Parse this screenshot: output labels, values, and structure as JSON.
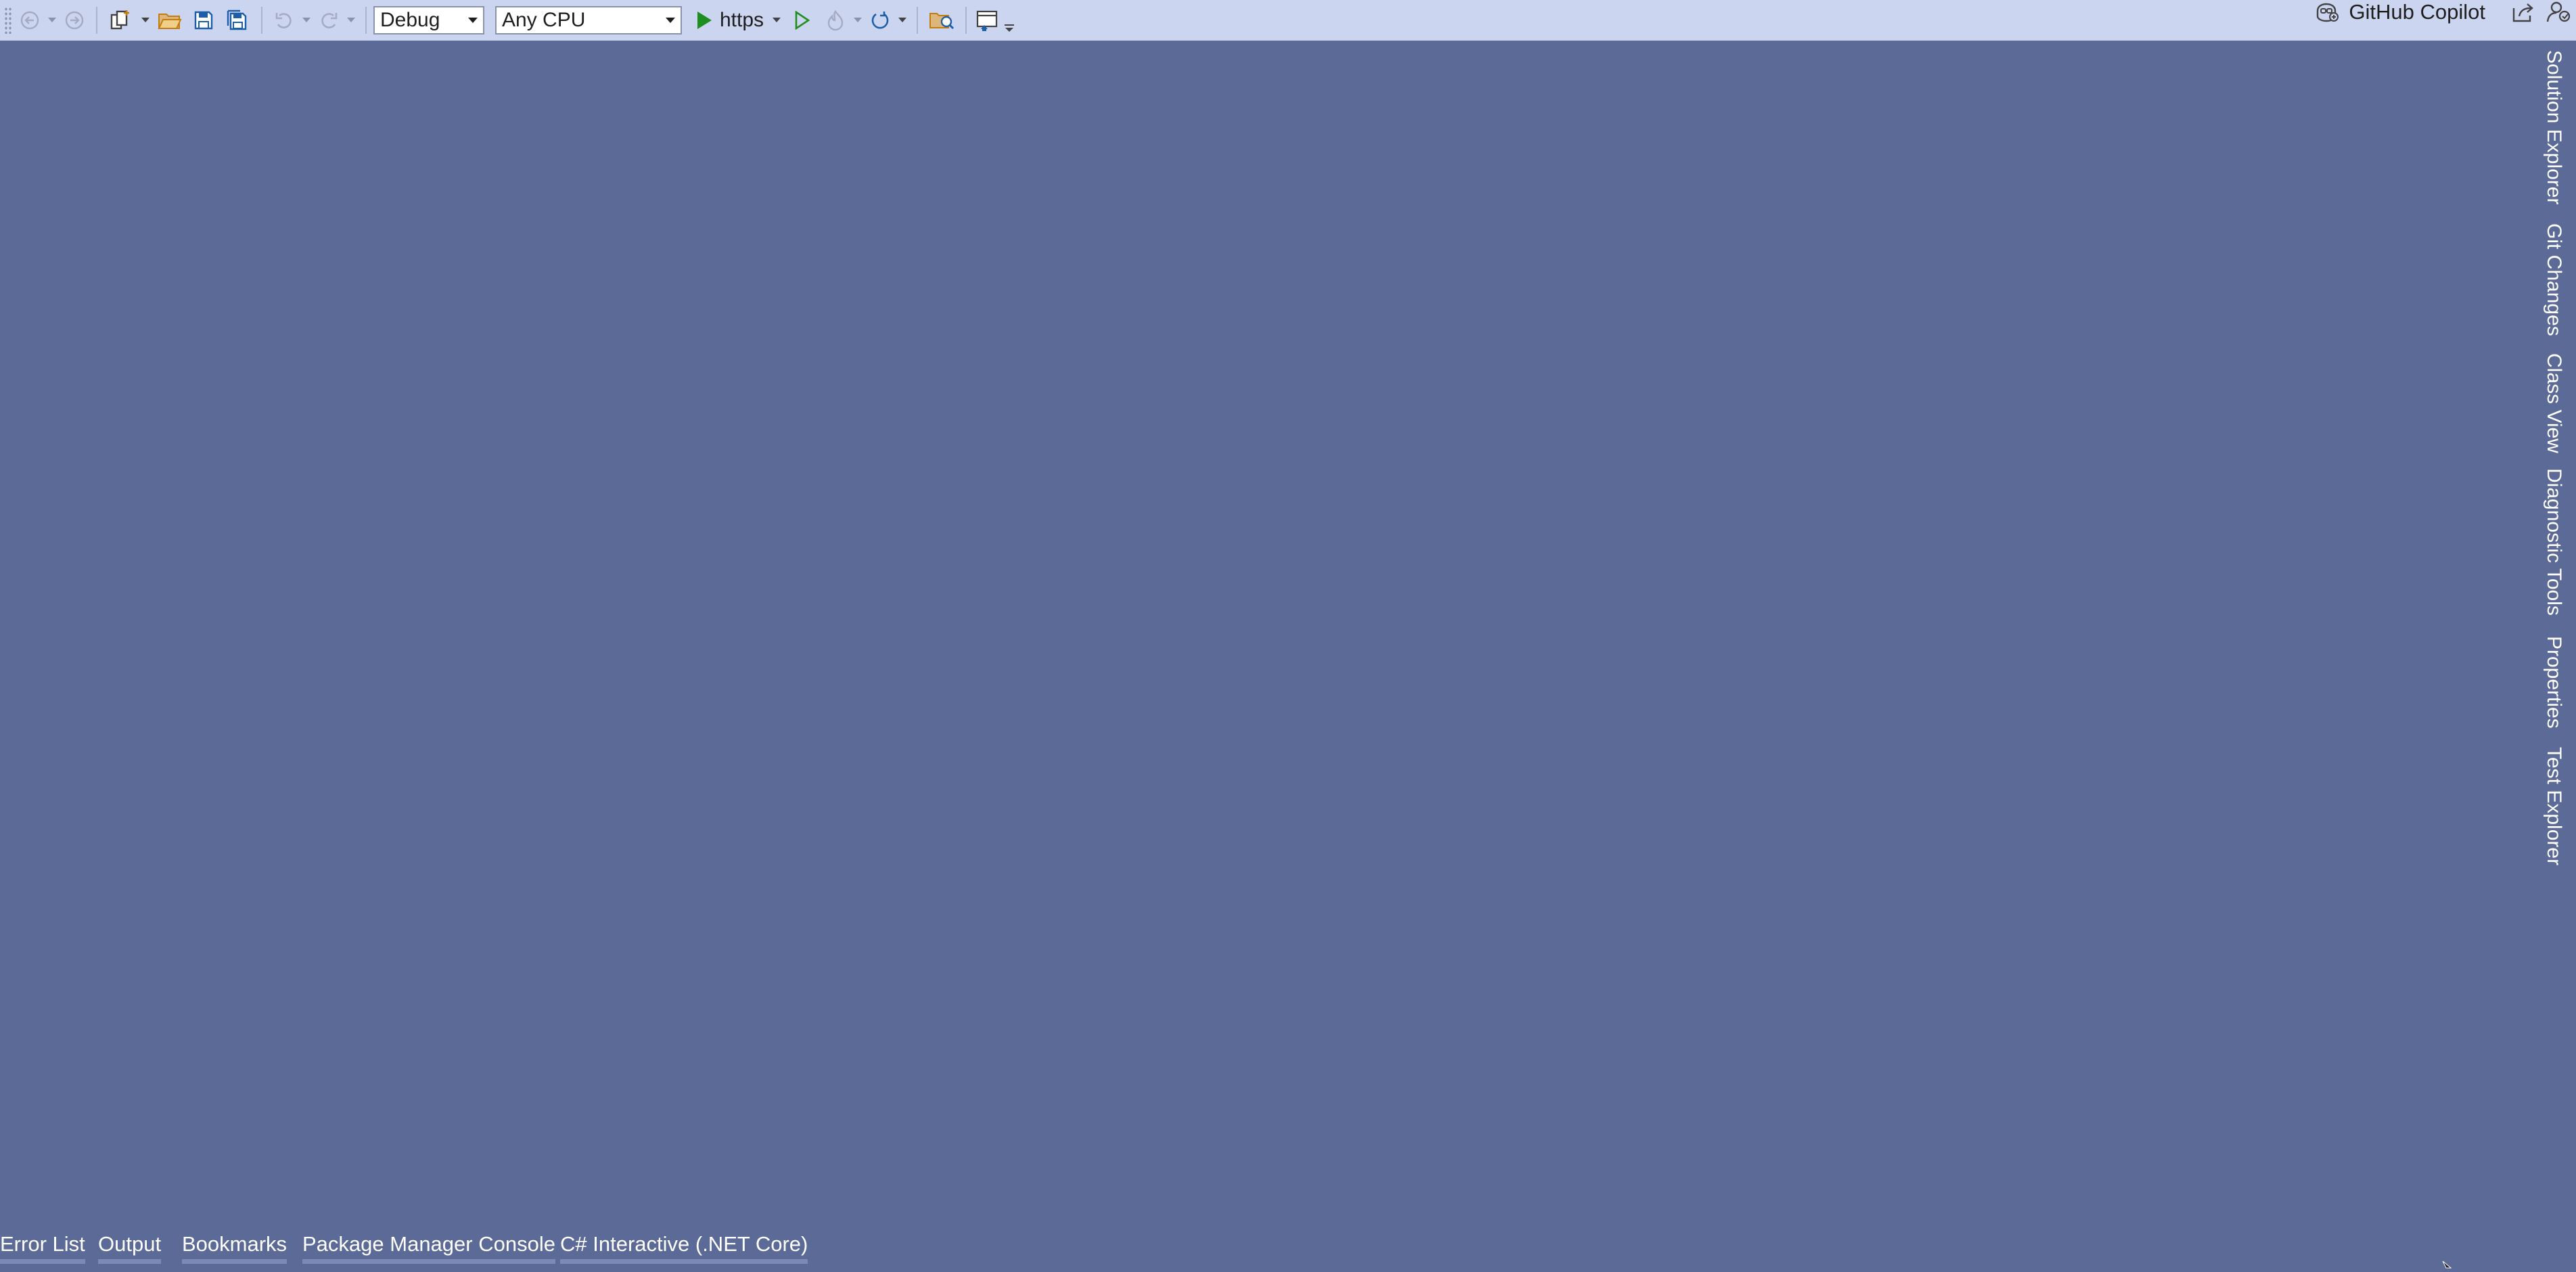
{
  "toolbar": {
    "configuration": "Debug",
    "platform": "Any CPU",
    "run_target": "https",
    "copilot_label": "GitHub Copilot",
    "icons": [
      "grip-icon",
      "back-arrow-icon",
      "forward-arrow-icon",
      "new-project-icon",
      "open-folder-icon",
      "save-icon",
      "save-all-icon",
      "undo-icon",
      "redo-icon",
      "start-debugging-icon",
      "start-without-debugging-icon",
      "hot-reload-icon",
      "restart-icon",
      "solution-explorer-search-icon",
      "window-layout-icon",
      "copilot-icon",
      "share-icon",
      "account-icon"
    ]
  },
  "right_rail": {
    "tabs": [
      "Solution Explorer",
      "Git Changes",
      "Class View",
      "Diagnostic Tools",
      "Properties",
      "Test Explorer"
    ]
  },
  "bottom_panel": {
    "tabs": [
      "Error List",
      "Output",
      "Bookmarks",
      "Package Manager Console",
      "C# Interactive (.NET Core)"
    ]
  },
  "colors": {
    "workspace_background": "#5b6a97",
    "toolbar_background": "#ccd5f0",
    "tab_text": "#ffffff",
    "run_green": "#1e8e1e"
  }
}
